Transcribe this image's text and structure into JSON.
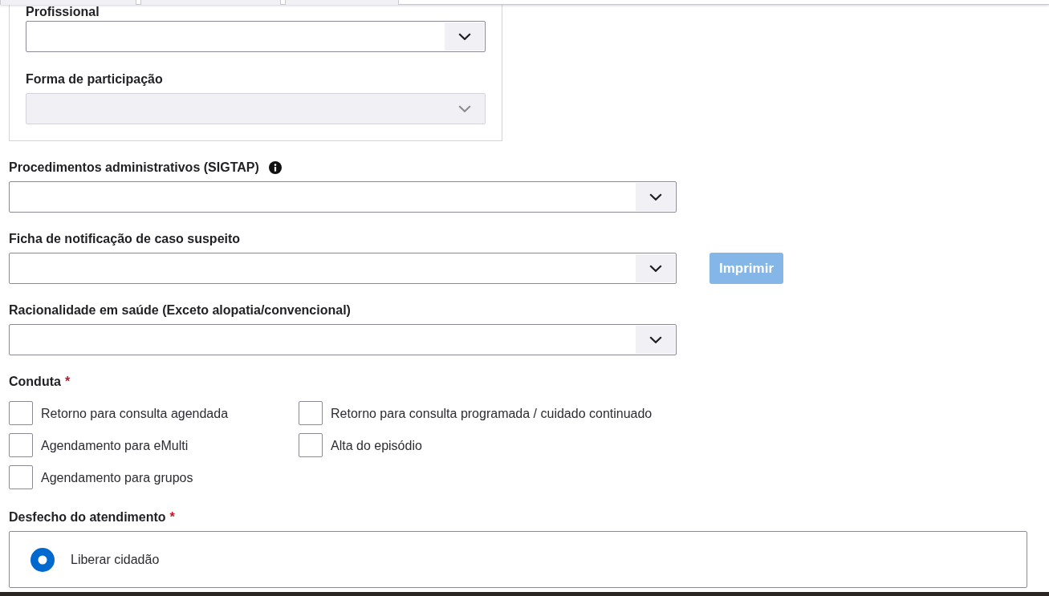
{
  "professional_panel": {
    "fields": [
      {
        "label": "Profissional",
        "disabled": false
      },
      {
        "label": "Forma de participação",
        "disabled": true
      }
    ]
  },
  "fields": [
    {
      "label": "Procedimentos administrativos (SIGTAP)",
      "info": true,
      "disabled": false
    },
    {
      "label": "Ficha de notificação de caso suspeito",
      "info": false,
      "disabled": false,
      "button": {
        "label": "Imprimir",
        "disabled": true
      }
    },
    {
      "label": "Racionalidade em saúde (Exceto alopatia/convencional)",
      "info": false,
      "disabled": false
    }
  ],
  "conduta": {
    "label": "Conduta",
    "required_mark": "*",
    "options": [
      {
        "label": "Retorno para consulta agendada",
        "checked": false
      },
      {
        "label": "Retorno para consulta programada / cuidado continuado",
        "checked": false
      },
      {
        "label": "Agendamento para eMulti",
        "checked": false
      },
      {
        "label": "Alta do episódio",
        "checked": false
      },
      {
        "label": "Agendamento para grupos",
        "checked": false
      }
    ]
  },
  "desfecho": {
    "label": "Desfecho do atendimento",
    "required_mark": "*",
    "options": [
      {
        "label": "Liberar cidadão",
        "selected": true
      }
    ]
  }
}
